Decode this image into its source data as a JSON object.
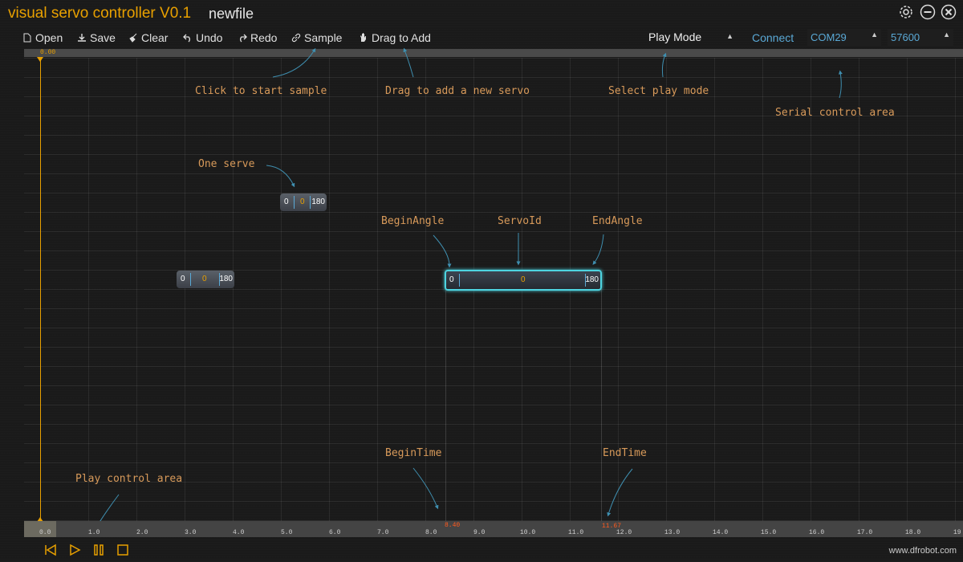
{
  "app": {
    "title": "visual servo controller V0.1",
    "file_name": "newfile"
  },
  "toolbar": {
    "open": "Open",
    "save": "Save",
    "clear": "Clear",
    "undo": "Undo",
    "redo": "Redo",
    "sample": "Sample",
    "drag_to_add": "Drag to Add"
  },
  "serial": {
    "play_mode": "Play Mode",
    "connect": "Connect",
    "com_port": "COM29",
    "baud_rate": "57600"
  },
  "top_ruler": {
    "position": "0.00"
  },
  "annotations": {
    "click_sample": "Click to start sample",
    "drag_add": "Drag to add a new servo",
    "select_mode": "Select play mode",
    "serial_area": "Serial control area",
    "one_servo": "One serve",
    "begin_angle": "BeginAngle",
    "servo_id": "ServoId",
    "end_angle": "EndAngle",
    "begin_time": "BeginTime",
    "end_time": "EndTime",
    "play_area": "Play control area"
  },
  "servos": [
    {
      "begin": "0",
      "id": "0",
      "end": "180"
    },
    {
      "begin": "0",
      "id": "0",
      "end": "180"
    },
    {
      "begin": "0",
      "id": "0",
      "end": "180"
    }
  ],
  "timeline": {
    "ticks": [
      "0.0",
      "1.0",
      "2.0",
      "3.0",
      "4.0",
      "5.0",
      "6.0",
      "7.0",
      "8.0",
      "9.0",
      "10.0",
      "11.0",
      "12.0",
      "13.0",
      "14.0",
      "15.0",
      "16.0",
      "17.0",
      "18.0",
      "19"
    ],
    "begin_marker": "8.40",
    "end_marker": "11.67"
  },
  "footer": {
    "url": "www.dfrobot.com"
  },
  "colors": {
    "accent": "#e8a000",
    "link": "#5aa9d6",
    "annotation": "#d89a5a",
    "selected": "#4ed4e0"
  }
}
